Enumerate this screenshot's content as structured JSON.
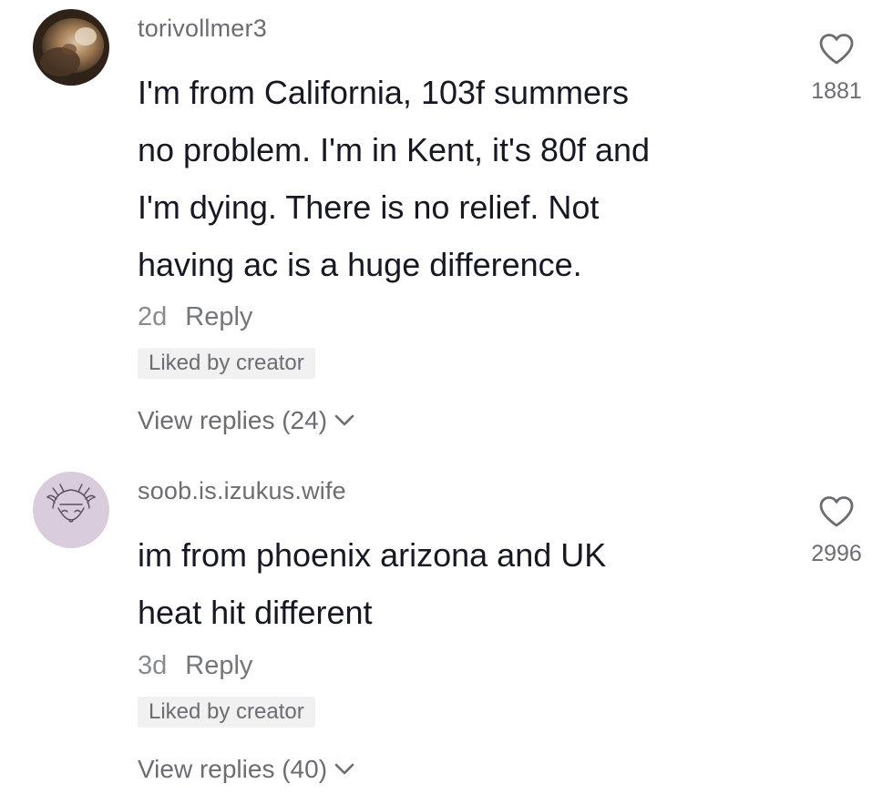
{
  "comments": [
    {
      "username": "torivollmer3",
      "text": "I'm from California, 103f summers\nno problem. I'm in Kent, it's 80f and\nI'm dying. There is no relief. Not\nhaving ac is a huge difference.",
      "age": "2d",
      "reply_label": "Reply",
      "liked_badge": "Liked by creator",
      "view_replies": "View replies (24)",
      "likes": "1881",
      "avatar": "avatar-photo-lion"
    },
    {
      "username": "soob.is.izukus.wife",
      "text": "im from phoenix arizona and UK\nheat hit different",
      "age": "3d",
      "reply_label": "Reply",
      "liked_badge": "Liked by creator",
      "view_replies": "View replies (40)",
      "likes": "2996",
      "avatar": "avatar-anime-sketch"
    }
  ],
  "icons": {
    "like": "heart-outline-icon",
    "expand": "chevron-down-icon"
  },
  "colors": {
    "text": "#161823",
    "secondary": "#6c6d73",
    "badge_bg": "#f1f1f2",
    "avatar2_bg": "#d9ccdc"
  }
}
